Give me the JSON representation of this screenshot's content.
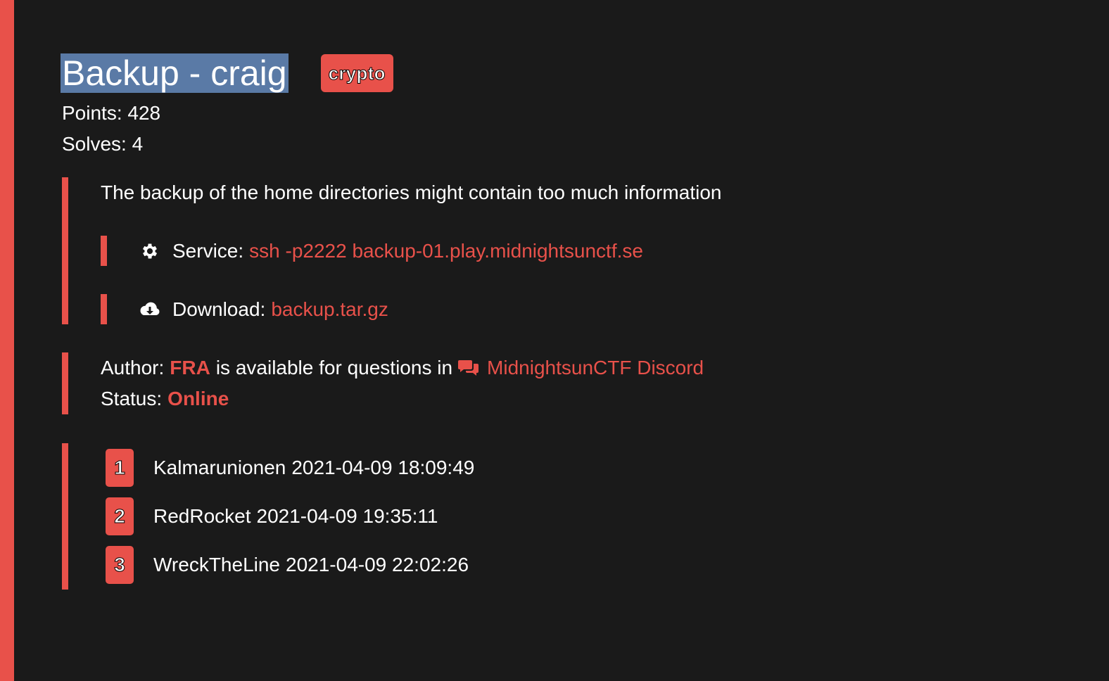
{
  "challenge": {
    "title": "Backup - craig",
    "category_tag": "crypto",
    "points_label": "Points:",
    "points": "428",
    "solves_label": "Solves:",
    "solves": "4",
    "description": "The backup of the home directories might contain too much information"
  },
  "service": {
    "icon": "gear-icon",
    "label": "Service:",
    "value": "ssh -p2222 backup-01.play.midnightsunctf.se"
  },
  "download": {
    "icon": "cloud-download-icon",
    "label": "Download:",
    "value": "backup.tar.gz"
  },
  "author": {
    "label": "Author:",
    "name": "FRA",
    "middle_text": "is available for questions in",
    "chat_icon": "chat-icon",
    "discord_link": "MidnightsunCTF Discord",
    "status_label": "Status:",
    "status_value": "Online"
  },
  "solvers": [
    {
      "rank": "1",
      "team": "Kalmarunionen",
      "time": "2021-04-09 18:09:49"
    },
    {
      "rank": "2",
      "team": "RedRocket",
      "time": "2021-04-09 19:35:11"
    },
    {
      "rank": "3",
      "team": "WreckTheLine",
      "time": "2021-04-09 22:02:26"
    }
  ],
  "colors": {
    "accent": "#e8514a",
    "background": "#1a1a1a",
    "selection": "#5a7aa6",
    "text": "#ffffff"
  }
}
